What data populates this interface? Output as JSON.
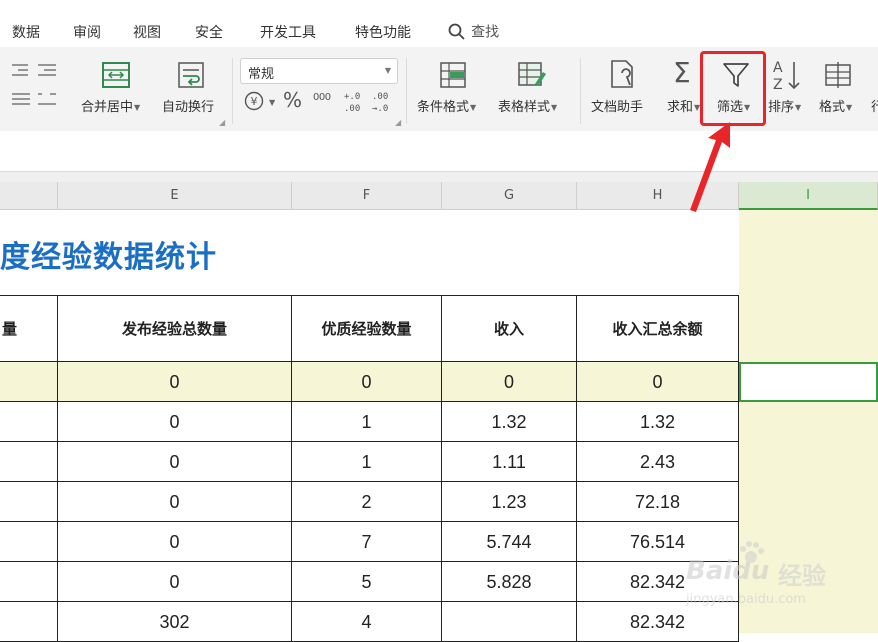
{
  "menu_tabs": [
    "数据",
    "审阅",
    "视图",
    "安全",
    "开发工具",
    "特色功能"
  ],
  "search_label": "查找",
  "ribbon": {
    "merge_center": "合并居中",
    "wrap_text": "自动换行",
    "number_format": "常规",
    "percent": "%",
    "thousands": "000",
    "inc_decimal": "+.0\n.00",
    "dec_decimal": ".00\n→.0",
    "conditional_format": "条件格式",
    "table_style": "表格样式",
    "doc_helper": "文档助手",
    "sum": "求和",
    "filter": "筛选",
    "sort": "排序",
    "format": "格式",
    "rowcol": "行"
  },
  "columns": [
    "E",
    "F",
    "G",
    "H",
    "I"
  ],
  "sheet_title": "度经验数据统计",
  "table": {
    "partial_header": "量",
    "headers": [
      "发布经验总数量",
      "优质经验数量",
      "收入",
      "收入汇总余额"
    ],
    "rows": [
      [
        "0",
        "0",
        "0",
        "0"
      ],
      [
        "0",
        "1",
        "1.32",
        "1.32"
      ],
      [
        "0",
        "1",
        "1.11",
        "2.43"
      ],
      [
        "0",
        "2",
        "1.23",
        "72.18"
      ],
      [
        "0",
        "7",
        "5.744",
        "76.514"
      ],
      [
        "0",
        "5",
        "5.828",
        "82.342"
      ],
      [
        "302",
        "4",
        "",
        "82.342"
      ]
    ]
  },
  "watermark": {
    "brand": "Baidu",
    "text": "经验",
    "url": "jingyan.baidu.com"
  },
  "colors": {
    "accent_red": "#e8262a",
    "title_blue": "#1a6fc4",
    "selected_green": "#3a9b3a",
    "highlight_yellow": "#f6f6d6"
  }
}
